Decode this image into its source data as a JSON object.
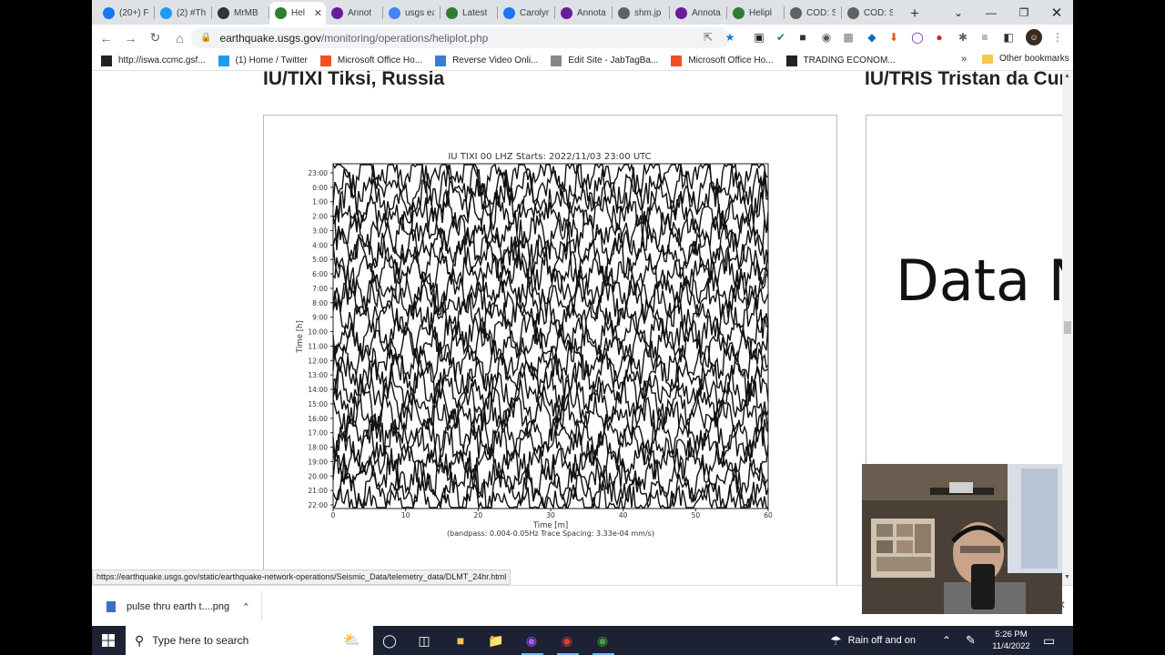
{
  "browser": {
    "tabs": [
      {
        "label": "(20+) F",
        "icon": "facebook-icon",
        "color": "#1877f2"
      },
      {
        "label": "(2) #Th",
        "icon": "twitter-icon",
        "color": "#1d9bf0"
      },
      {
        "label": "MrMB",
        "icon": "avatar-icon",
        "color": "#333333"
      },
      {
        "label": "Hel",
        "icon": "usgs-icon",
        "color": "#2e7d32",
        "active": true
      },
      {
        "label": "Annot",
        "icon": "annotate-icon",
        "color": "#6a1b9a"
      },
      {
        "label": "usgs ea",
        "icon": "google-icon",
        "color": "#4285f4"
      },
      {
        "label": "Latest",
        "icon": "usgs-icon",
        "color": "#2e7d32"
      },
      {
        "label": "Carolyn",
        "icon": "facebook-icon",
        "color": "#1877f2"
      },
      {
        "label": "Annota",
        "icon": "annotate-icon",
        "color": "#6a1b9a"
      },
      {
        "label": "shm.jp",
        "icon": "globe-icon",
        "color": "#5f6368"
      },
      {
        "label": "Annota",
        "icon": "annotate-icon",
        "color": "#6a1b9a"
      },
      {
        "label": "Helipl",
        "icon": "usgs-icon",
        "color": "#2e7d32"
      },
      {
        "label": "COD: S",
        "icon": "cod-icon",
        "color": "#616161"
      },
      {
        "label": "COD: S",
        "icon": "cod-icon",
        "color": "#616161"
      }
    ],
    "url_host": "earthquake.usgs.gov",
    "url_path": "/monitoring/operations/heliplot.php",
    "bookmarks": [
      {
        "label": "http://iswa.ccmc.gsf...",
        "color": "#222222"
      },
      {
        "label": "(1) Home / Twitter",
        "color": "#1d9bf0"
      },
      {
        "label": "Microsoft Office Ho...",
        "color": "#f25022"
      },
      {
        "label": "Reverse Video Onli...",
        "color": "#3a7bd5"
      },
      {
        "label": "Edit Site - JabTagBa...",
        "color": "#888888"
      },
      {
        "label": "Microsoft Office Ho...",
        "color": "#f25022"
      },
      {
        "label": "TRADING ECONOM...",
        "color": "#222222"
      }
    ],
    "bookmarks_more": "»",
    "other_bookmarks": "Other bookmarks",
    "status_url": "https://earthquake.usgs.gov/static/earthquake-network-operations/Seismic_Data/telemetry_data/DLMT_24hr.html"
  },
  "page": {
    "station1_title": "IU/TIXI Tiksi, Russia",
    "station2_title": "IU/TRIS Tristan da Cun",
    "station2_placeholder": "Data N"
  },
  "chart_data": {
    "type": "line",
    "title": "IU TIXI 00 LHZ  Starts: 2022/11/03 23:00 UTC",
    "xlabel": "Time [m]",
    "ylabel": "Time [h]",
    "footnote": "(bandpass: 0.004-0.05Hz  Trace Spacing: 3.33e-04 mm/s)",
    "xlim": [
      0,
      60
    ],
    "x_ticks": [
      "0",
      "10",
      "20",
      "30",
      "40",
      "50",
      "60"
    ],
    "y_ticks": [
      "23:00",
      "0:00",
      "1:00",
      "2:00",
      "3:00",
      "4:00",
      "5:00",
      "6:00",
      "7:00",
      "8:00",
      "9:00",
      "10:00",
      "11:00",
      "12:00",
      "13:00",
      "14:00",
      "15:00",
      "16:00",
      "17:00",
      "18:00",
      "19:00",
      "20:00",
      "21:00",
      "22:00"
    ],
    "series": [
      {
        "values": [
          23
        ]
      }
    ]
  },
  "downloads": {
    "file": "pulse thru earth t....png"
  },
  "taskbar": {
    "search_placeholder": "Type here to search",
    "weather": "Rain off and on",
    "time": "5:26 PM",
    "date": "11/4/2022"
  }
}
